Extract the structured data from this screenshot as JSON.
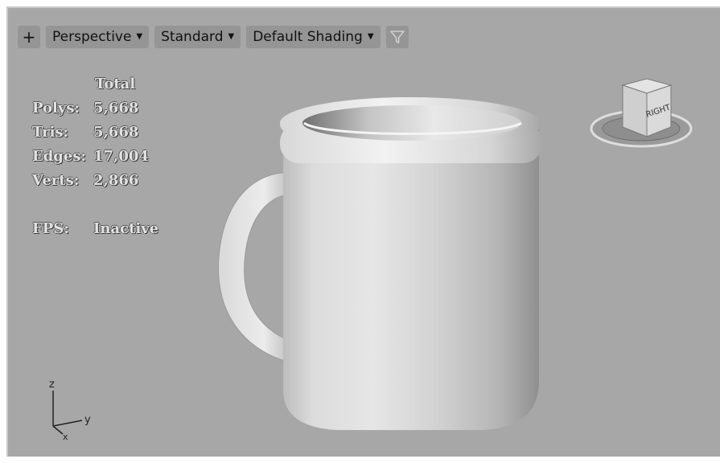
{
  "toolbar": {
    "plus_label": "+",
    "view_label": "Perspective",
    "mode_label": "Standard",
    "shading_label": "Default Shading",
    "dropdown_caret": "▼",
    "filter_icon": "funnel-icon"
  },
  "stats": {
    "header": "Total",
    "polys_label": "Polys:",
    "polys_value": "5,668",
    "tris_label": "Tris:",
    "tris_value": "5,668",
    "edges_label": "Edges:",
    "edges_value": "17,004",
    "verts_label": "Verts:",
    "verts_value": "2,866",
    "fps_label": "FPS:",
    "fps_value": "Inactive"
  },
  "viewcube": {
    "face_label": "RIGHT"
  },
  "axis": {
    "z_label": "z",
    "y_label": "y",
    "x_label": "x"
  },
  "colors": {
    "viewport_bg": "#a7a7a7",
    "button_bg": "#959595",
    "stats_text": "#e2e2e2"
  }
}
